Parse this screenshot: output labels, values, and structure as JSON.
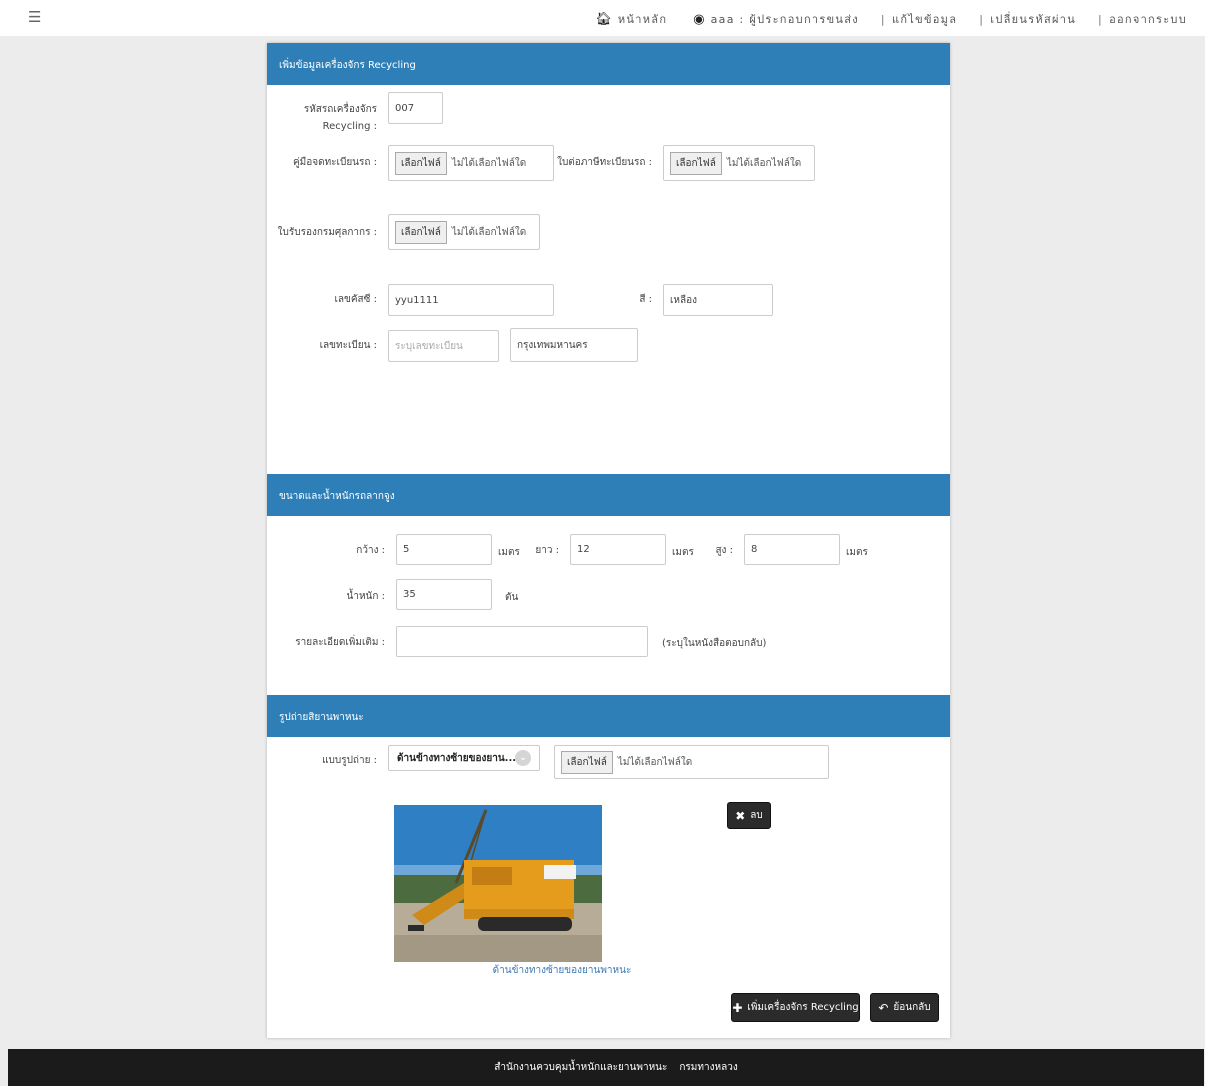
{
  "topnav": {
    "menu_icon": "hamburger-icon",
    "home_label": "หน้าหลัก",
    "user_label": "aaa : ผู้ประกอบการขนส่ง",
    "edit_label": "แก้ไขข้อมูล",
    "password_label": "เปลี่ยนรหัสผ่าน",
    "logout_label": "ออกจากระบบ",
    "separator": "|"
  },
  "section1": {
    "title": "เพิ่มข้อมูลเครื่องจักร Recycling",
    "code_label": "รหัสรถเครื่องจักร Recycling :",
    "code_value": "007",
    "manual_label": "คู่มือจดทะเบียนรถ :",
    "renew_label": "ใบต่อภาษีทะเบียนรถ :",
    "customs_label": "ใบรับรองกรมศุลกากร :",
    "file_button": "เลือกไฟล์",
    "file_none": "ไม่ได้เลือกไฟล์ใด",
    "vin_label": "เลขคัสซี :",
    "vin_value": "yyu1111",
    "color_label": "สี :",
    "color_value": "เหลือง",
    "plate_label": "เลขทะเบียน :",
    "plate_placeholder": "ระบุเลขทะเบียน",
    "province_value": "กรุงเทพมหานคร"
  },
  "section2": {
    "title": "ขนาดและน้ำหนักรถลากจูง",
    "width_label": "กว้าง :",
    "width_value": "5",
    "length_label": "ยาว :",
    "length_value": "12",
    "height_label": "สูง :",
    "height_value": "8",
    "unit_meter": "เมตร",
    "weight_label": "น้ำหนัก :",
    "weight_value": "35",
    "unit_ton": "ตัน",
    "detail_label": "รายละเอียดเพิ่มเติม :",
    "detail_value": "",
    "detail_note": "(ระบุในหนังสือตอบกลับ)"
  },
  "section3": {
    "title": "รูปถ่ายสิยานพาหนะ",
    "photo_type_label": "แบบรูปถ่าย :",
    "photo_type_value": "ด้านข้างทางซ้ายของยาน...",
    "file_button": "เลือกไฟล์",
    "file_none": "ไม่ได้เลือกไฟล์ใด",
    "delete_label": "ลบ",
    "photo_caption": "ด้านข้างทางซ้ายของยานพาหนะ",
    "add_button": "เพิ่มเครื่องจักร Recycling",
    "back_button": "ย้อนกลับ"
  },
  "footer": {
    "org": "สำนักงานควบคุมน้ำหนักและยานพาหนะ",
    "dept": "กรมทางหลวง"
  }
}
